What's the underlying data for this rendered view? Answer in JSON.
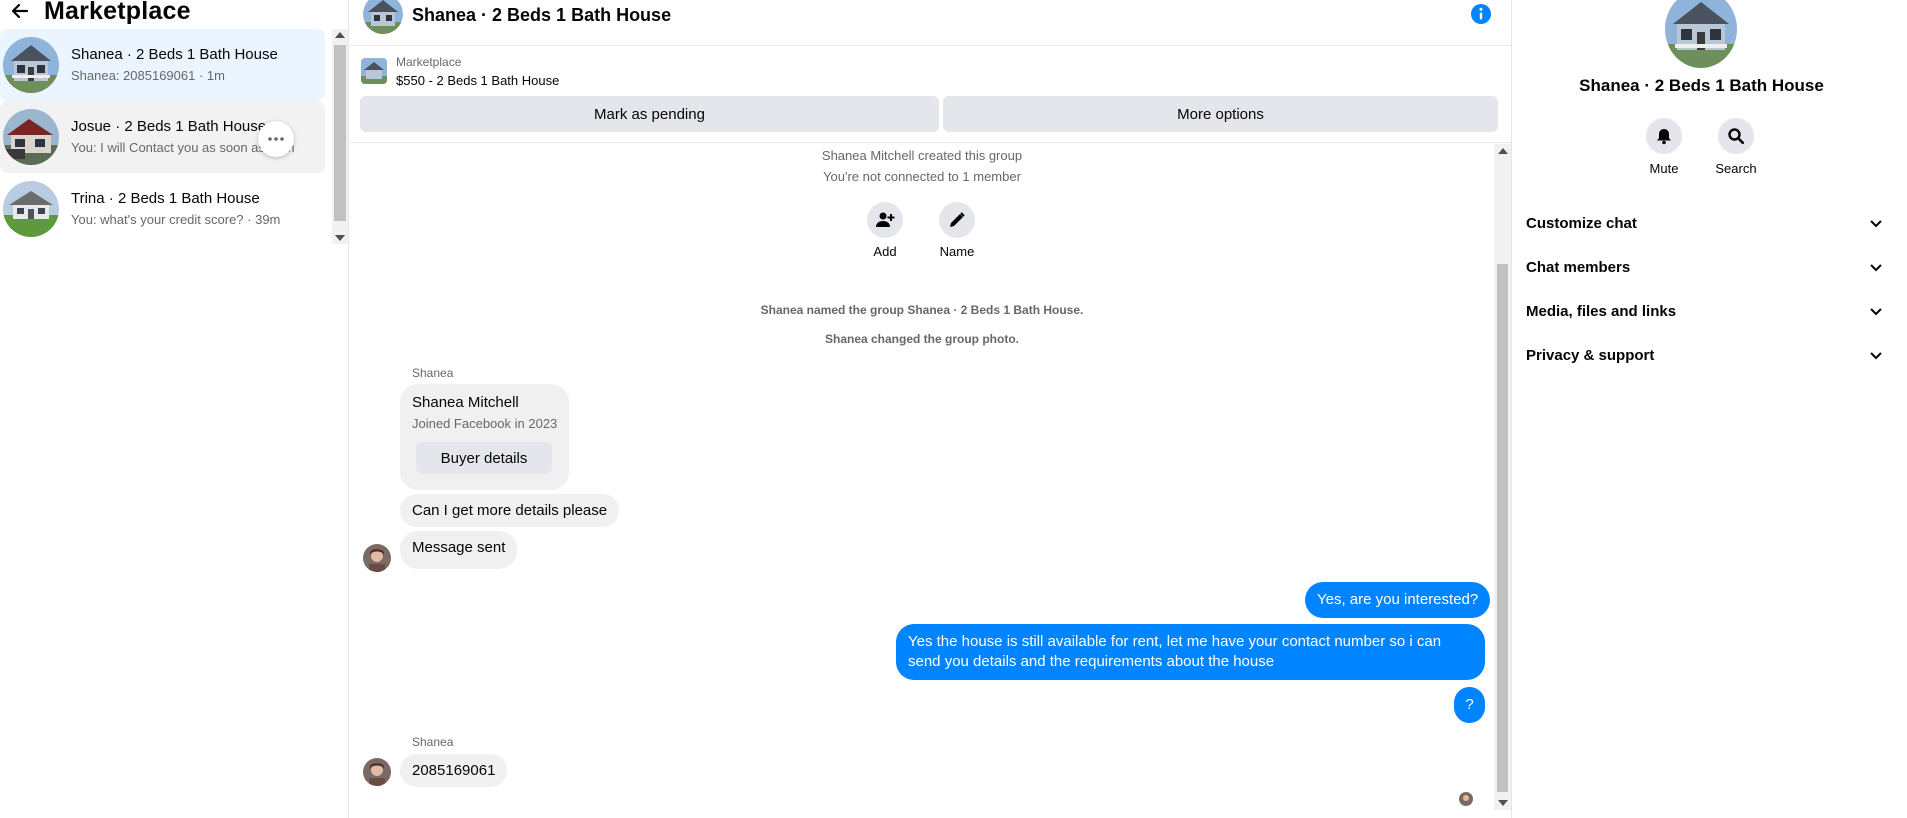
{
  "sidebar": {
    "title": "Marketplace",
    "conversations": [
      {
        "name": "Shanea · 2 Beds 1 Bath House",
        "preview": "Shanea: 2085169061 · 1m"
      },
      {
        "name": "Josue · 2 Beds 1 Bath House",
        "preview": "You: I will Contact you as soon as ·  1m"
      },
      {
        "name": "Trina · 2 Beds 1 Bath House",
        "preview": "You: what's your credit score? · 39m"
      }
    ]
  },
  "chat": {
    "title": "Shanea · 2 Beds 1 Bath House",
    "listing": {
      "label": "Marketplace",
      "price_title": "$550 - 2 Beds 1 Bath House",
      "pending_label": "Mark as pending",
      "more_label": "More options"
    },
    "system": {
      "created": "Shanea Mitchell created this group",
      "not_connected": "You're not connected to 1 member",
      "named": "Shanea named the group Shanea · 2 Beds 1 Bath House.",
      "photo": "Shanea changed the group photo."
    },
    "group_actions": {
      "add": "Add",
      "name": "Name"
    },
    "sender_name": "Shanea",
    "buyer_card": {
      "name": "Shanea Mitchell",
      "joined": "Joined Facebook in 2023",
      "button": "Buyer details"
    },
    "incoming": [
      "Can I get more details please",
      "Message sent"
    ],
    "outgoing": [
      "Yes, are you interested?",
      "Yes the house is still available for rent, let me have your contact number so i can send you details and the requirements about the house",
      "?"
    ],
    "last_sender": "Shanea",
    "last_message": "2085169061"
  },
  "panel": {
    "name": "Shanea · 2 Beds 1 Bath House",
    "mute": "Mute",
    "search": "Search",
    "sections": [
      "Customize chat",
      "Chat members",
      "Media, files and links",
      "Privacy & support"
    ]
  },
  "colors": {
    "accent": "#0084ff",
    "active_bg": "#ebf5ff",
    "bubble_in": "#f0f0f0",
    "button_gray": "#e4e6eb"
  },
  "icons": [
    "back-arrow-icon",
    "more-icon",
    "info-icon",
    "add-person-icon",
    "pencil-icon",
    "bell-icon",
    "search-icon",
    "chevron-down-icon"
  ]
}
